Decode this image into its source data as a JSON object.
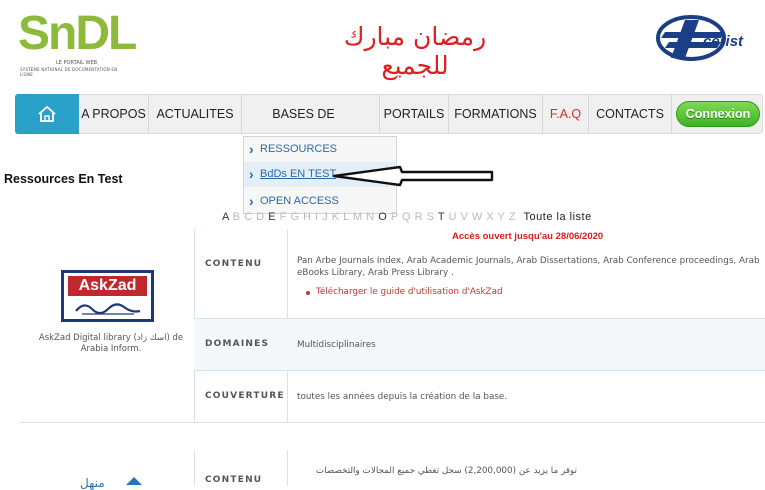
{
  "header": {
    "logo": {
      "text": "SnDL",
      "tagline": "LE PORTAIL WEB",
      "subtitle": "SYSTÈME NATIONAL DE DOCUMENTATION EN LIGNE"
    },
    "greeting": "رمضان مبارك للجميع",
    "partner_logo": "cerist"
  },
  "nav": {
    "home_icon": "home-icon",
    "items": [
      "A PROPOS",
      "ACTUALITES",
      "BASES DE DONNEES",
      "PORTAILS",
      "FORMATIONS",
      "F.A.Q",
      "CONTACTS"
    ],
    "dropdown_caret": "▾",
    "connexion": "Connexion"
  },
  "dropdown": {
    "items": [
      "RESSOURCES",
      "BdDs EN TEST",
      "OPEN ACCESS"
    ],
    "active_index": 1
  },
  "page": {
    "section_title": "Ressources En Test",
    "alphabet": [
      "A",
      "B",
      "C",
      "D",
      "E",
      "F",
      "G",
      "H",
      "I",
      "J",
      "K",
      "L",
      "M",
      "N",
      "O",
      "P",
      "Q",
      "R",
      "S",
      "T",
      "U",
      "V",
      "W",
      "X",
      "Y",
      "Z"
    ],
    "alphabet_active": [
      "A",
      "E",
      "O",
      "T"
    ],
    "all_list": "Toute la liste"
  },
  "resources": [
    {
      "access_note": "Accès ouvert jusqu'au 28/06/2020",
      "logo_text": "AskZad",
      "description": "AskZad Digital library (اسك زاد) de Arabia Inform.",
      "labels": {
        "contenu": "CONTENU",
        "domaines": "DOMAINES",
        "couverture": "COUVERTURE"
      },
      "contenu_text": "Pan Arbe Journals Index, Arab Academic Journals, Arab Dissertations, Arab Conference proceedings, Arab eBooks Library, Arab Press Library .",
      "guide_link": "Télécharger le guide d'utilisation d'AskZad",
      "domaines": "Multidisciplinaires",
      "couverture": "toutes les années depuis la création de la base."
    },
    {
      "labels": {
        "contenu": "CONTENU"
      },
      "logo_text": "منهل",
      "contenu_text": "توفر ما يزيد عن (2,200,000) سجل تغطي جميع المجالات والتخصصات"
    }
  ],
  "colors": {
    "accent_blue": "#2aa1c9",
    "connexion_green": "#4cbf2b",
    "greeting_red": "#e01e1e",
    "logo_green": "#8dba3a"
  }
}
